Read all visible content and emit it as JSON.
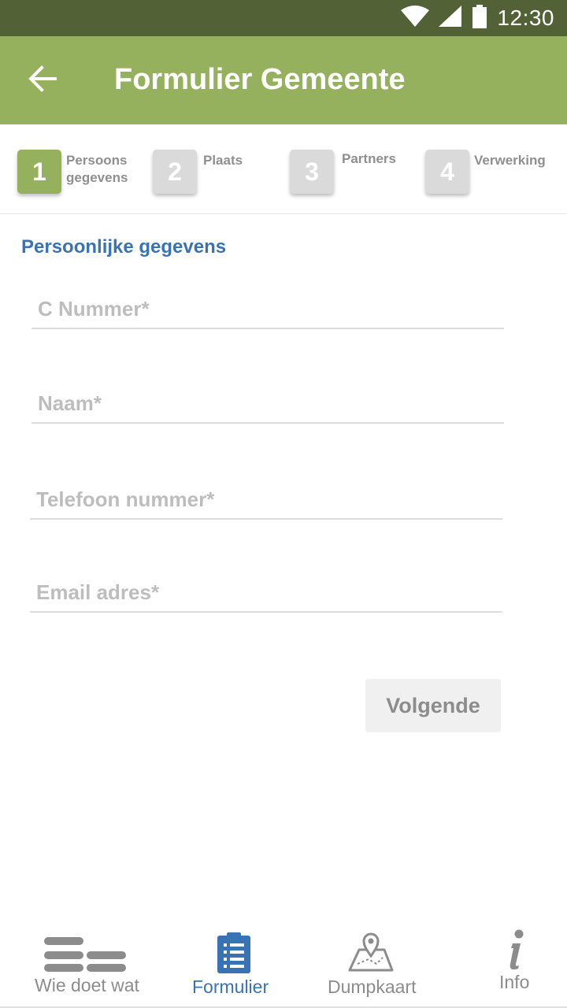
{
  "status_bar": {
    "time": "12:30",
    "icons": [
      "wifi-icon",
      "signal-icon",
      "battery-icon"
    ]
  },
  "app_bar": {
    "title": "Formulier Gemeente",
    "back_icon": "arrow-left-icon",
    "color": "#95b15e"
  },
  "stepper": {
    "steps": [
      {
        "number": "1",
        "label_line1": "Persoons",
        "label_line2": "gegevens",
        "active": true
      },
      {
        "number": "2",
        "label_line1": "Plaats",
        "label_line2": "",
        "active": false
      },
      {
        "number": "3",
        "label_line1": "Partners",
        "label_line2": "",
        "active": false
      },
      {
        "number": "4",
        "label_line1": "Verwerking",
        "label_line2": "",
        "active": false
      }
    ]
  },
  "form": {
    "section_title": "Persoonlijke gegevens",
    "fields": [
      {
        "placeholder": "C Nummer*",
        "value": ""
      },
      {
        "placeholder": "Naam*",
        "value": ""
      },
      {
        "placeholder": "Telefoon nummer*",
        "value": ""
      },
      {
        "placeholder": "Email adres*",
        "value": ""
      }
    ],
    "next_button": "Volgende"
  },
  "bottom_nav": {
    "items": [
      {
        "label": "Wie doet wat",
        "icon": "list-grid-icon",
        "active": false
      },
      {
        "label": "Formulier",
        "icon": "clipboard-list-icon",
        "active": true
      },
      {
        "label": "Dumpkaart",
        "icon": "map-pin-icon",
        "active": false
      },
      {
        "label": "Info",
        "icon": "info-icon",
        "active": false
      }
    ]
  },
  "colors": {
    "status_bar": "#526136",
    "accent_green": "#95b15e",
    "accent_blue": "#3a73b4"
  }
}
